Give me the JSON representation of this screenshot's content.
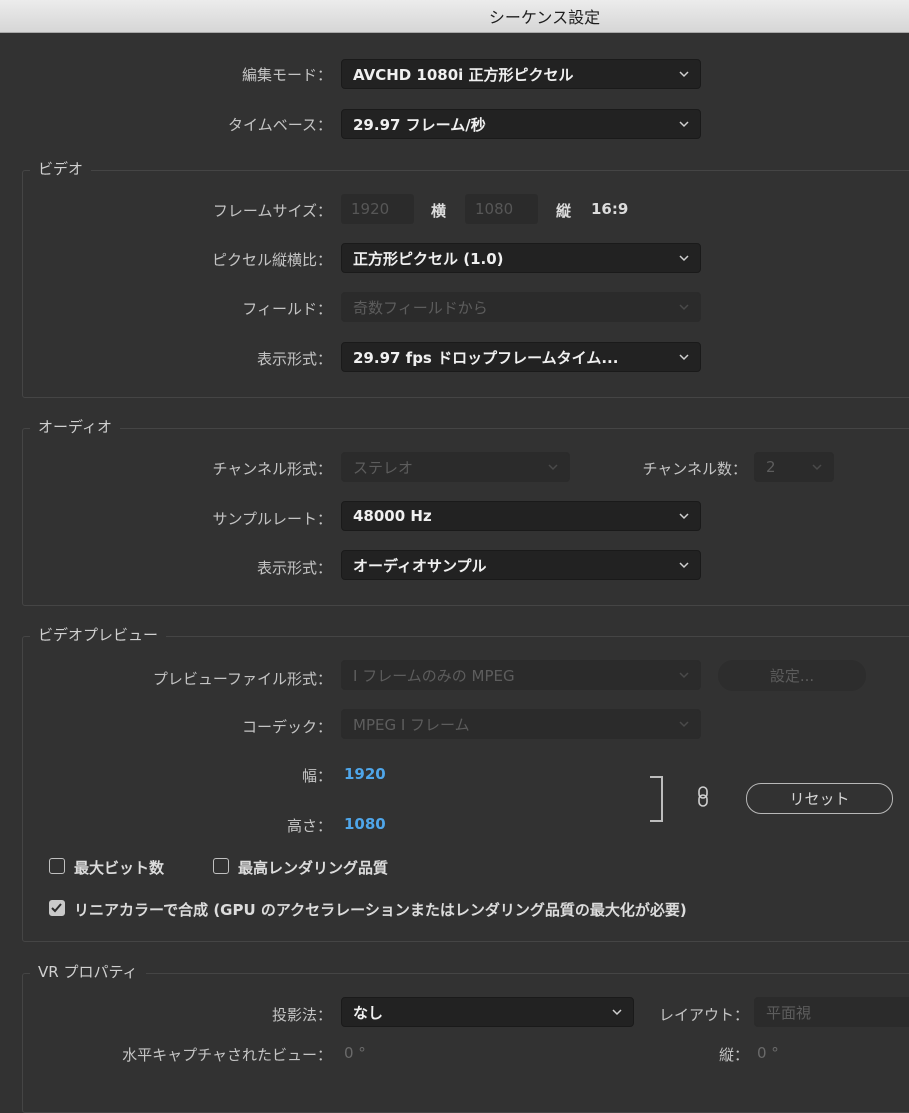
{
  "window": {
    "title": "シーケンス設定"
  },
  "edit_mode": {
    "label": "編集モード：",
    "value": "AVCHD 1080i 正方形ピクセル"
  },
  "timebase": {
    "label": "タイムベース：",
    "value": "29.97  フレーム/秒"
  },
  "video": {
    "title": "ビデオ",
    "frame_size_label": "フレームサイズ：",
    "width_value": "1920",
    "horizontal_label": "横",
    "height_value": "1080",
    "vertical_label": "縦",
    "aspect": "16:9",
    "pixel_aspect_label": "ピクセル縦横比：",
    "pixel_aspect_value": "正方形ピクセル (1.0)",
    "fields_label": "フィールド：",
    "fields_value": "奇数フィールドから",
    "display_format_label": "表示形式：",
    "display_format_value": "29.97 fps ドロップフレームタイム..."
  },
  "audio": {
    "title": "オーディオ",
    "channel_format_label": "チャンネル形式：",
    "channel_format_value": "ステレオ",
    "channel_count_label": "チャンネル数：",
    "channel_count_value": "2",
    "sample_rate_label": "サンプルレート：",
    "sample_rate_value": "48000 Hz",
    "display_format_label": "表示形式：",
    "display_format_value": "オーディオサンプル"
  },
  "video_preview": {
    "title": "ビデオプレビュー",
    "file_format_label": "プレビューファイル形式：",
    "file_format_value": "I フレームのみの MPEG",
    "settings_button": "設定...",
    "codec_label": "コーデック：",
    "codec_value": "MPEG I フレーム",
    "width_label": "幅：",
    "width_value": "1920",
    "height_label": "高さ：",
    "height_value": "1080",
    "reset_button": "リセット",
    "max_bit_depth": "最大ビット数",
    "max_render_quality": "最高レンダリング品質",
    "linear_color": "リニアカラーで合成 (GPU のアクセラレーションまたはレンダリング品質の最大化が必要)",
    "linear_color_checked": true
  },
  "vr": {
    "title": "VR プロパティ",
    "projection_label": "投影法：",
    "projection_value": "なし",
    "layout_label": "レイアウト：",
    "layout_value": "平面視",
    "h_view_label": "水平キャプチャされたビュー：",
    "h_view_value": "0 °",
    "v_view_label": "縦：",
    "v_view_value": "0 °"
  },
  "icons": {
    "dropdown": "chevron-down-icon",
    "link": "link-chain-icon",
    "check": "checkmark-icon"
  }
}
